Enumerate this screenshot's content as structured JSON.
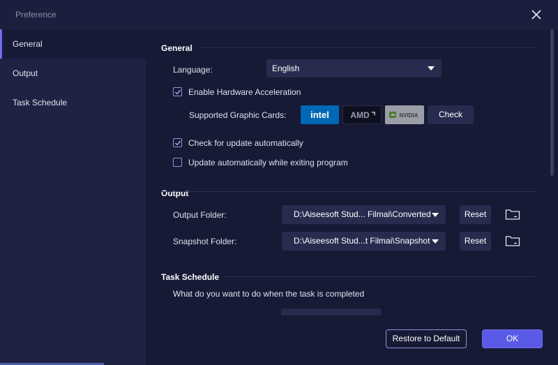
{
  "window": {
    "title": "Preference"
  },
  "sidebar": {
    "items": [
      {
        "label": "General",
        "active": true
      },
      {
        "label": "Output",
        "active": false
      },
      {
        "label": "Task Schedule",
        "active": false
      }
    ]
  },
  "general": {
    "title": "General",
    "language_label": "Language:",
    "language_value": "English",
    "hw_accel_label": "Enable Hardware Acceleration",
    "hw_accel_checked": true,
    "graphic_cards_label": "Supported Graphic Cards:",
    "cards": [
      "intel",
      "AMD",
      "NVIDIA"
    ],
    "check_button": "Check",
    "auto_update_label": "Check for update automatically",
    "auto_update_checked": true,
    "update_on_exit_label": "Update automatically while exiting program",
    "update_on_exit_checked": false
  },
  "output": {
    "title": "Output",
    "output_folder_label": "Output Folder:",
    "output_folder_value": "D:\\Aiseesoft Stud... Filmai\\Converted",
    "snapshot_folder_label": "Snapshot Folder:",
    "snapshot_folder_value": "D:\\Aiseesoft Stud...t Filmai\\Snapshot",
    "reset_label": "Reset"
  },
  "task_schedule": {
    "title": "Task Schedule",
    "question": "What do you want to do when the task is completed"
  },
  "footer": {
    "restore_label": "Restore to Default",
    "ok_label": "OK"
  },
  "colors": {
    "background": "#161a35",
    "sidebar": "#1e2344",
    "accent": "#6e6df0",
    "intel_blue": "#0068b5"
  }
}
